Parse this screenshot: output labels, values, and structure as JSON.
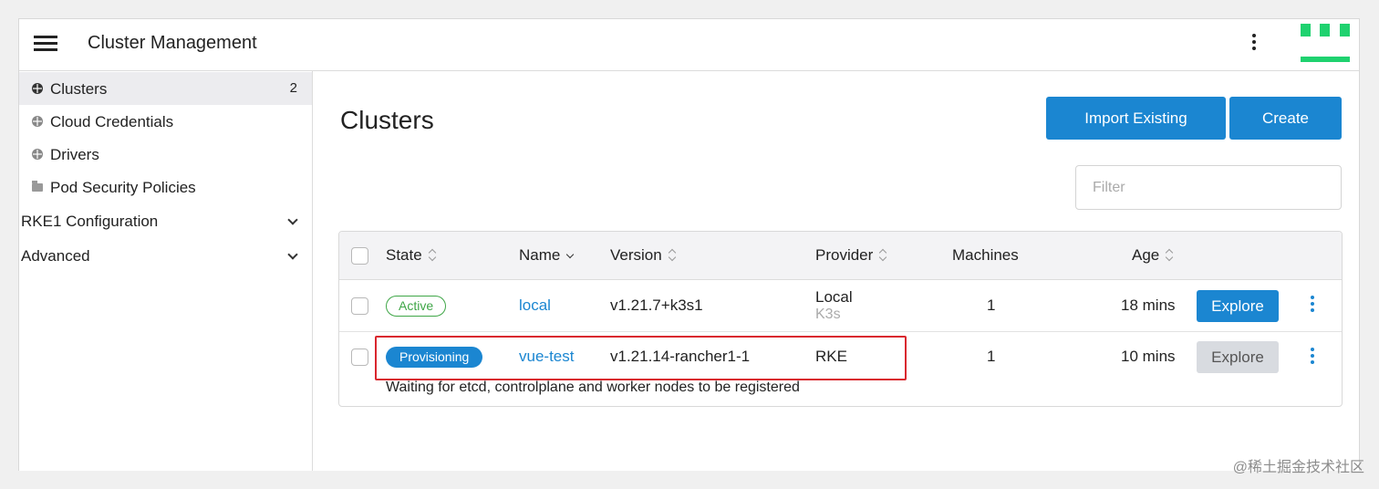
{
  "header": {
    "title": "Cluster Management"
  },
  "sidebar": {
    "items": [
      {
        "label": "Clusters",
        "count": "2",
        "icon": "globe-icon"
      },
      {
        "label": "Cloud Credentials",
        "icon": "globe-icon"
      },
      {
        "label": "Drivers",
        "icon": "globe-icon"
      },
      {
        "label": "Pod Security Policies",
        "icon": "folder-icon"
      }
    ],
    "groups": [
      {
        "label": "RKE1 Configuration"
      },
      {
        "label": "Advanced"
      }
    ]
  },
  "main": {
    "title": "Clusters",
    "import_label": "Import Existing",
    "create_label": "Create",
    "filter_placeholder": "Filter"
  },
  "table": {
    "columns": [
      "State",
      "Name",
      "Version",
      "Provider",
      "Machines",
      "Age"
    ],
    "rows": [
      {
        "state": "Active",
        "name": "local",
        "version": "v1.21.7+k3s1",
        "provider": "Local",
        "provider_sub": "K3s",
        "machines": "1",
        "age": "18 mins",
        "action": "Explore"
      },
      {
        "state": "Provisioning",
        "name": "vue-test",
        "version": "v1.21.14-rancher1-1",
        "provider": "RKE",
        "machines": "1",
        "age": "10 mins",
        "action": "Explore",
        "message": "Waiting for etcd, controlplane and worker nodes to be registered"
      }
    ]
  },
  "colors": {
    "primary": "#1b86d1",
    "active": "#3fa647",
    "highlight": "#d9262e",
    "logo": "#1fd26f"
  },
  "watermark": "@稀土掘金技术社区"
}
